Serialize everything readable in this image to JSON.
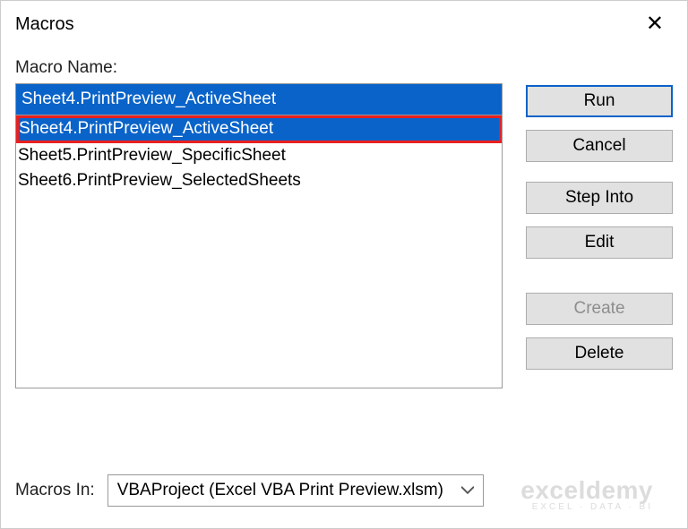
{
  "window": {
    "title": "Macros",
    "close_glyph": "✕"
  },
  "labels": {
    "macro_name": "Macro Name:",
    "macros_in": "Macros In:"
  },
  "macro_name_value": "Sheet4.PrintPreview_ActiveSheet",
  "macro_list": [
    {
      "label": "Sheet4.PrintPreview_ActiveSheet",
      "selected": true,
      "highlighted": true
    },
    {
      "label": "Sheet5.PrintPreview_SpecificSheet",
      "selected": false,
      "highlighted": false
    },
    {
      "label": "Sheet6.PrintPreview_SelectedSheets",
      "selected": false,
      "highlighted": false
    }
  ],
  "buttons": {
    "run": "Run",
    "cancel": "Cancel",
    "step_into": "Step Into",
    "edit": "Edit",
    "create": "Create",
    "delete": "Delete"
  },
  "macros_in_value": "VBAProject (Excel VBA Print Preview.xlsm)",
  "watermark": {
    "line1": "exceldemy",
    "line2": "EXCEL · DATA · BI"
  }
}
